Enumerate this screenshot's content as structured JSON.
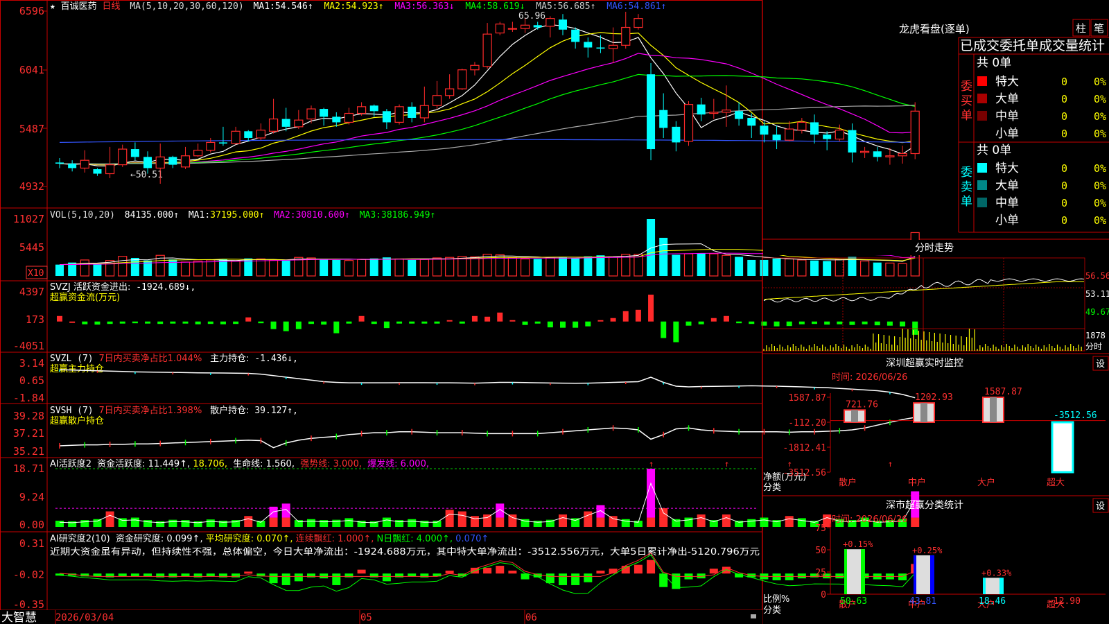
{
  "stock": {
    "name": "百诚医药",
    "period": "日线",
    "star": "★"
  },
  "colors": {
    "up": "#ff2a2a",
    "down": "#00ff00",
    "cyan": "#00ffff",
    "axis": "#c80000",
    "ma1": "#ffffff",
    "ma2": "#ffff00",
    "ma3": "#ff00ff",
    "ma4": "#00ff00",
    "ma5": "#aaaaaa",
    "ma6": "#3355ff"
  },
  "main": {
    "ma_label": "MA(5,10,20,30,60,120)",
    "ma_items": [
      {
        "name": "MA1:",
        "value": "54.546↑"
      },
      {
        "name": "MA2:",
        "value": "54.923↑"
      },
      {
        "name": "MA3:",
        "value": "56.363↓"
      },
      {
        "name": "MA4:",
        "value": "58.619↓"
      },
      {
        "name": "MA5:",
        "value": "56.685↑"
      },
      {
        "name": "MA6:",
        "value": "54.861↑"
      }
    ],
    "y_ticks": [
      "6596",
      "6041",
      "5487",
      "4932"
    ],
    "annotation_high": "65.96",
    "annotation_low": "←50.51"
  },
  "vol": {
    "label": "VOL(5,10,20)",
    "value": "84135.000↑",
    "items": [
      {
        "name": "MA1:",
        "value": "37195.000↑"
      },
      {
        "name": "MA2:",
        "value": "30810.600↑"
      },
      {
        "name": "MA3:",
        "value": "38186.949↑"
      }
    ],
    "y_ticks": [
      "11027",
      "5445"
    ],
    "unit": "X10"
  },
  "svzj": {
    "label": "SVZJ  活跃资金进出:",
    "value": "-1924.689↓,",
    "sub": "超赢资金流(万元)",
    "y_ticks": [
      "4397",
      "173",
      "-4051"
    ]
  },
  "svzl": {
    "label": "SVZL (7)",
    "desc": "7日内买卖净占比1.044%",
    "item": "主力持仓:",
    "value": "-1.436↓,",
    "sub": "超赢主力持仓",
    "y_ticks": [
      "3.14",
      "0.65",
      "-1.84"
    ]
  },
  "svsh": {
    "label": "SVSH (7)",
    "desc": "7日内买卖净占比1.398%",
    "item": "散户持仓:",
    "value": "39.127↑,",
    "sub": "超赢散户持仓",
    "y_ticks": [
      "39.28",
      "37.21",
      "35.21"
    ]
  },
  "active": {
    "label": "AI活跃度2",
    "item": "资金活跃度:",
    "v1": "11.449↑,",
    "v2": "18.706,",
    "life": "生命线: 1.560,",
    "strong": "强势线: 3.000,",
    "burst": "爆发线: 6.000,",
    "y_ticks": [
      "18.71",
      "9.24",
      "0.00"
    ]
  },
  "research": {
    "label": "AI研究度2(10)",
    "item": "资金研究度: 0.099↑,",
    "avg": "平均研究度: 0.070↑,",
    "streak": "连续飘红: 1.000↑,",
    "nday": "N日飘红: 4.000↑,",
    "last": "0.070↑",
    "comment": "近期大资金虽有异动，但持续性不强，总体偏空，今日大单净流出：-1924.688万元，其中特大单净流出：-3512.556万元，大单5日累计净出-5120.796万元",
    "y_ticks": [
      "0.31",
      "-0.02",
      "-0.35"
    ]
  },
  "xaxis": {
    "brand": "大智慧",
    "labels": [
      "2026/03/04",
      "05",
      "06"
    ]
  },
  "dragon": {
    "title": "龙虎看盘(逐单)",
    "btn1": "柱",
    "btn2": "笔",
    "subtitle": "已成交委托单成交量统计",
    "buy_label": "委买单",
    "sell_label": "委卖单",
    "buy_total": "共 0单",
    "sell_total": "共 0单",
    "buy_rows": [
      {
        "name": "特大",
        "count": "0",
        "pct": "0%",
        "color": "#ff0000"
      },
      {
        "name": "大单",
        "count": "0",
        "pct": "0%",
        "color": "#aa0000"
      },
      {
        "name": "中单",
        "count": "0",
        "pct": "0%",
        "color": "#770000"
      },
      {
        "name": "小单",
        "count": "0",
        "pct": "0%",
        "color": "#000000"
      }
    ],
    "sell_rows": [
      {
        "name": "特大",
        "count": "0",
        "pct": "0%",
        "color": "#00ffff"
      },
      {
        "name": "大单",
        "count": "0",
        "pct": "0%",
        "color": "#008888"
      },
      {
        "name": "中单",
        "count": "0",
        "pct": "0%",
        "color": "#006666"
      },
      {
        "name": "小单",
        "count": "0",
        "pct": "0%",
        "color": "#000000"
      }
    ]
  },
  "intraday": {
    "title": "分时走势",
    "price_ticks": [
      "56.56",
      "53.11",
      "49.67"
    ],
    "vol_tick": "1878",
    "vol_label": "分时"
  },
  "sz_monitor": {
    "title": "深圳超赢实时监控",
    "settings": "设",
    "time": "时间: 2026/06/26",
    "y_ticks": [
      "1587.87",
      "-112.20",
      "-1812.41",
      "-3512.56"
    ],
    "ylabel1": "净额(万元)",
    "ylabel2": "分类",
    "bars": [
      {
        "cat": "散户",
        "value": 721.76,
        "label": "721.76"
      },
      {
        "cat": "中户",
        "value": 1202.93,
        "label": "1202.93"
      },
      {
        "cat": "大户",
        "value": 1587.87,
        "label": "1587.87"
      },
      {
        "cat": "超大",
        "value": -3512.56,
        "label": "-3512.56"
      }
    ]
  },
  "sz_class": {
    "title": "深市超赢分类统计",
    "settings": "设",
    "time": "时间: 2026/06/26",
    "y_ticks": [
      "75",
      "50",
      "25",
      "0"
    ],
    "ylabel1": "比例%",
    "ylabel2": "分类",
    "bars": [
      {
        "cat": "散户",
        "value": 50.63,
        "label": "50.63",
        "delta": "+0.15%"
      },
      {
        "cat": "中户",
        "value": 43.81,
        "label": "43.81",
        "delta": "+0.25%"
      },
      {
        "cat": "大户",
        "value": 18.46,
        "label": "18.46",
        "delta": "+0.33%"
      },
      {
        "cat": "超大",
        "value": -12.9,
        "label": "-12.90",
        "delta": ""
      }
    ]
  },
  "chart_data": [
    {
      "type": "candlestick",
      "title": "百诚医药 日线",
      "ylim": [
        49.32,
        65.96
      ],
      "candles": [
        [
          52.4,
          52.3,
          52.8,
          51.9
        ],
        [
          52.3,
          51.9,
          52.6,
          51.6
        ],
        [
          51.9,
          52.6,
          53.5,
          51.5
        ],
        [
          51.8,
          51.4,
          51.9,
          51.2
        ],
        [
          51.4,
          52.2,
          53.8,
          51.0
        ],
        [
          52.2,
          53.6,
          54.0,
          52.0
        ],
        [
          53.6,
          52.9,
          54.2,
          52.6
        ],
        [
          52.9,
          51.9,
          53.4,
          51.4
        ],
        [
          51.9,
          52.9,
          54.1,
          50.5
        ],
        [
          52.9,
          52.2,
          53.0,
          51.9
        ],
        [
          52.0,
          53.0,
          53.8,
          51.8
        ],
        [
          53.0,
          53.5,
          54.1,
          52.9
        ],
        [
          53.5,
          54.2,
          54.6,
          53.3
        ],
        [
          54.2,
          54.1,
          55.6,
          53.9
        ],
        [
          54.1,
          55.2,
          55.6,
          54.0
        ],
        [
          55.2,
          54.6,
          55.3,
          54.3
        ],
        [
          54.6,
          55.3,
          55.9,
          54.4
        ],
        [
          55.2,
          56.3,
          58.1,
          55.0
        ],
        [
          56.3,
          55.6,
          57.3,
          55.2
        ],
        [
          55.6,
          56.2,
          57.1,
          55.4
        ],
        [
          56.3,
          57.2,
          57.5,
          55.9
        ],
        [
          57.2,
          56.5,
          57.3,
          55.7
        ],
        [
          56.5,
          56.0,
          56.9,
          55.6
        ],
        [
          56.0,
          56.8,
          57.3,
          55.8
        ],
        [
          56.8,
          57.4,
          57.8,
          56.6
        ],
        [
          57.5,
          57.0,
          57.6,
          56.5
        ],
        [
          57.0,
          56.0,
          57.2,
          55.4
        ],
        [
          56.0,
          57.4,
          57.6,
          55.8
        ],
        [
          57.4,
          56.4,
          57.8,
          56.0
        ],
        [
          56.4,
          57.5,
          59.2,
          56.0
        ],
        [
          57.5,
          58.4,
          59.7,
          57.2
        ],
        [
          58.4,
          59.0,
          60.3,
          58.1
        ],
        [
          59.0,
          60.7,
          60.8,
          58.9
        ],
        [
          60.7,
          61.1,
          61.4,
          60.2
        ],
        [
          61.0,
          63.9,
          64.9,
          60.8
        ],
        [
          64.0,
          64.8,
          65.0,
          63.8
        ],
        [
          64.4,
          64.4,
          65.0,
          64.1
        ],
        [
          64.4,
          64.7,
          65.3,
          64.0
        ],
        [
          64.7,
          64.5,
          65.0,
          64.3
        ],
        [
          64.6,
          65.3,
          65.5,
          63.6
        ],
        [
          65.2,
          64.3,
          65.7,
          63.8
        ],
        [
          64.3,
          63.2,
          64.5,
          62.6
        ],
        [
          63.2,
          62.7,
          63.6,
          61.8
        ],
        [
          62.7,
          62.6,
          63.8,
          62.2
        ],
        [
          62.6,
          62.9,
          64.5,
          61.3
        ],
        [
          62.9,
          64.5,
          65.9,
          62.6
        ],
        [
          64.5,
          65.3,
          65.7,
          64.3
        ],
        [
          60.3,
          53.6,
          61.3,
          52.6
        ],
        [
          57.1,
          55.5,
          58.6,
          54.6
        ],
        [
          55.6,
          54.2,
          56.1,
          53.4
        ],
        [
          54.3,
          57.6,
          57.9,
          53.9
        ],
        [
          57.6,
          56.7,
          58.2,
          56.1
        ],
        [
          56.8,
          56.9,
          58.1,
          56.3
        ],
        [
          56.9,
          57.1,
          59.3,
          55.6
        ],
        [
          57.0,
          56.3,
          57.8,
          55.7
        ],
        [
          56.4,
          55.7,
          56.8,
          54.6
        ],
        [
          55.7,
          54.9,
          56.1,
          54.2
        ],
        [
          54.9,
          54.4,
          55.7,
          53.6
        ],
        [
          54.4,
          55.4,
          56.1,
          54.3
        ],
        [
          55.3,
          56.0,
          56.4,
          55.0
        ],
        [
          56.0,
          54.9,
          56.7,
          54.1
        ],
        [
          54.9,
          54.5,
          55.2,
          53.5
        ],
        [
          54.5,
          55.3,
          55.8,
          54.3
        ],
        [
          55.3,
          53.3,
          55.9,
          52.4
        ],
        [
          53.3,
          53.4,
          53.8,
          52.8
        ],
        [
          53.4,
          52.9,
          53.8,
          52.5
        ],
        [
          52.9,
          53.0,
          53.7,
          52.2
        ],
        [
          53.0,
          53.2,
          53.9,
          52.3
        ],
        [
          53.2,
          57.0,
          57.8,
          52.7
        ]
      ]
    },
    {
      "type": "bar",
      "title": "VOL(5,10,20)",
      "ylim": [
        0,
        11027
      ],
      "values": [
        2200,
        2600,
        3100,
        2400,
        3000,
        3800,
        3500,
        3000,
        4000,
        3200,
        2700,
        2900,
        3100,
        3300,
        2900,
        3400,
        3300,
        3100,
        3000,
        3600,
        3500,
        3200,
        3100,
        3000,
        3200,
        3400,
        3600,
        3300,
        3100,
        3200,
        3500,
        3600,
        3800,
        3700,
        4200,
        4100,
        3500,
        3300,
        3300,
        3500,
        3700,
        3400,
        3800,
        4000,
        3700,
        4200,
        4200,
        11027,
        7400,
        4100,
        4300,
        4400,
        4300,
        4000,
        3700,
        3100,
        3100,
        3400,
        3300,
        3100,
        3000,
        2900,
        3200,
        3700,
        2900,
        2600,
        2500,
        2400,
        8410
      ]
    },
    {
      "type": "bar",
      "title": "SVZJ 超赢资金流(万元)",
      "ylim": [
        -4051,
        4397
      ],
      "values": [
        800,
        0,
        -400,
        -450,
        -350,
        -300,
        -250,
        -300,
        -350,
        -300,
        -300,
        -400,
        -350,
        -400,
        -350,
        600,
        -250,
        -1100,
        -1400,
        -1100,
        -350,
        -450,
        -1700,
        -300,
        800,
        -350,
        -950,
        -300,
        -300,
        -300,
        -300,
        200,
        -300,
        800,
        700,
        1300,
        200,
        -500,
        -300,
        -850,
        -900,
        -900,
        -700,
        200,
        500,
        1500,
        1700,
        3900,
        -2400,
        -3000,
        -600,
        -400,
        500,
        800,
        -250,
        -350,
        -600,
        -700,
        -650,
        -400,
        -350,
        -450,
        -400,
        -500,
        -400,
        -550,
        -600,
        -700,
        -1924
      ]
    },
    {
      "type": "line",
      "title": "SVZL 超赢主力持仓",
      "ylim": [
        -1.84,
        3.14
      ],
      "values": [
        2.3,
        2.25,
        2.2,
        2.15,
        2.1,
        2.05,
        2.0,
        1.98,
        1.95,
        1.93,
        1.9,
        1.88,
        1.86,
        1.85,
        1.83,
        1.8,
        1.7,
        1.5,
        1.3,
        1.1,
        0.9,
        0.7,
        0.6,
        0.55,
        0.55,
        0.55,
        0.55,
        0.56,
        0.56,
        0.56,
        0.55,
        0.55,
        0.52,
        0.5,
        0.55,
        0.6,
        0.6,
        0.58,
        0.55,
        0.52,
        0.5,
        0.48,
        0.5,
        0.55,
        0.6,
        0.65,
        0.7,
        1.3,
        0.6,
        0.1,
        0.0,
        0.05,
        0.08,
        0.1,
        0.12,
        0.15,
        0.12,
        0.1,
        0.05,
        0.0,
        -0.05,
        -0.1,
        -0.2,
        -0.3,
        -0.4,
        -0.5,
        -0.7,
        -1.0,
        -1.44
      ]
    },
    {
      "type": "line",
      "title": "SVSH 超赢散户持仓",
      "ylim": [
        35.21,
        39.28
      ],
      "values": [
        36.1,
        36.15,
        36.2,
        36.2,
        36.25,
        36.25,
        36.3,
        36.3,
        36.35,
        36.4,
        36.45,
        36.5,
        36.55,
        36.6,
        36.65,
        36.7,
        36.65,
        35.9,
        36.4,
        36.7,
        36.9,
        37.0,
        37.1,
        37.3,
        37.4,
        37.5,
        37.5,
        37.6,
        37.6,
        37.55,
        37.5,
        37.5,
        37.5,
        37.45,
        37.4,
        37.4,
        37.4,
        37.4,
        37.4,
        37.5,
        37.6,
        37.7,
        37.8,
        37.9,
        38.0,
        37.95,
        37.8,
        36.8,
        37.3,
        37.9,
        38.0,
        37.8,
        37.7,
        37.65,
        37.6,
        37.6,
        37.6,
        37.6,
        37.55,
        37.6,
        37.6,
        37.65,
        37.7,
        37.8,
        38.0,
        38.3,
        38.6,
        38.9,
        39.13
      ]
    },
    {
      "type": "bar",
      "title": "AI活跃度2",
      "ylim": [
        0,
        18.71
      ],
      "values": [
        2.0,
        1.8,
        2.2,
        2.5,
        5.0,
        2.8,
        3.0,
        2.2,
        1.8,
        2.3,
        2.2,
        1.8,
        2.4,
        2.0,
        2.2,
        3.5,
        2.0,
        6.5,
        7.5,
        2.2,
        2.5,
        2.2,
        2.3,
        2.8,
        2.0,
        1.8,
        3.0,
        2.2,
        2.5,
        2.0,
        2.0,
        5.5,
        5.0,
        3.5,
        4.0,
        7.5,
        4.0,
        2.5,
        2.0,
        2.3,
        4.0,
        2.8,
        5.0,
        7.0,
        3.5,
        2.5,
        2.0,
        18.7,
        6.0,
        2.5,
        3.0,
        4.0,
        2.2,
        4.0,
        2.0,
        2.5,
        3.0,
        2.2,
        3.5,
        2.8,
        2.0,
        4.0,
        2.5,
        2.2,
        3.0,
        2.0,
        2.2,
        2.5,
        11.45
      ]
    },
    {
      "type": "bar",
      "title": "AI研究度2(10)",
      "ylim": [
        -0.35,
        0.31
      ],
      "values": [
        -0.02,
        -0.02,
        -0.03,
        -0.03,
        -0.04,
        -0.03,
        -0.03,
        -0.03,
        -0.04,
        -0.04,
        -0.03,
        -0.04,
        -0.03,
        -0.04,
        -0.04,
        0.02,
        -0.03,
        -0.1,
        -0.12,
        -0.08,
        -0.04,
        -0.05,
        -0.12,
        -0.04,
        0.04,
        -0.04,
        -0.08,
        -0.04,
        -0.03,
        -0.04,
        -0.03,
        0.03,
        -0.03,
        0.06,
        0.06,
        0.08,
        0.03,
        -0.06,
        -0.04,
        -0.1,
        -0.12,
        -0.12,
        -0.09,
        0.03,
        0.05,
        0.08,
        0.09,
        0.14,
        -0.14,
        -0.16,
        -0.06,
        -0.05,
        0.05,
        0.07,
        -0.04,
        -0.04,
        -0.06,
        -0.07,
        -0.07,
        -0.05,
        -0.04,
        -0.05,
        -0.05,
        -0.06,
        -0.05,
        -0.06,
        -0.06,
        -0.07,
        0.099
      ]
    }
  ]
}
